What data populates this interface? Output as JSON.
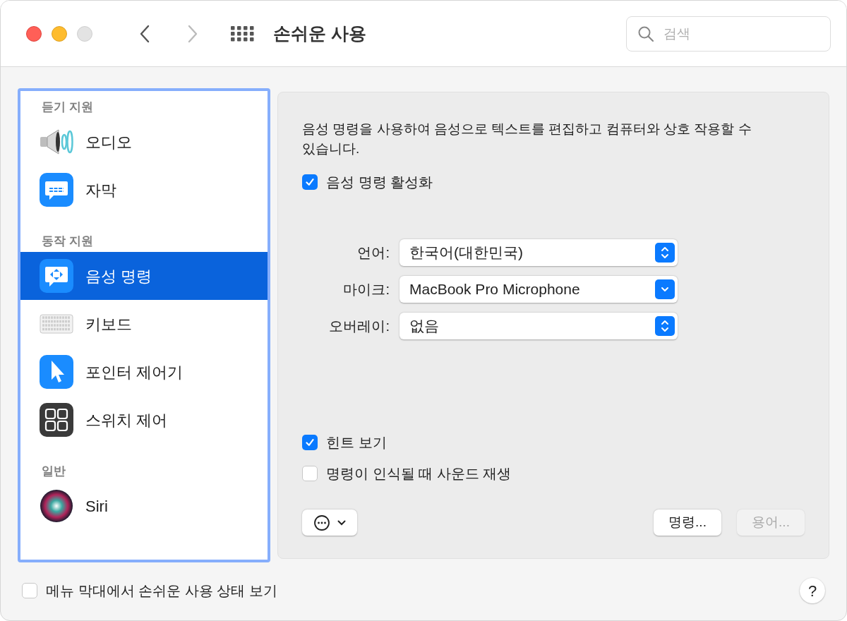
{
  "window": {
    "title": "손쉬운 사용",
    "back_disabled": false,
    "forward_disabled": true
  },
  "search": {
    "placeholder": "검색"
  },
  "sidebar": {
    "sections": [
      {
        "header": "듣기 지원",
        "items": [
          {
            "label": "오디오",
            "kind": "speaker",
            "selected": false
          },
          {
            "label": "자막",
            "kind": "captions",
            "selected": false
          }
        ]
      },
      {
        "header": "동작 지원",
        "items": [
          {
            "label": "음성 명령",
            "kind": "voice",
            "selected": true
          },
          {
            "label": "키보드",
            "kind": "keyboard",
            "selected": false
          },
          {
            "label": "포인터 제어기",
            "kind": "pointer",
            "selected": false
          },
          {
            "label": "스위치 제어",
            "kind": "switch",
            "selected": false
          }
        ]
      },
      {
        "header": "일반",
        "items": [
          {
            "label": "Siri",
            "kind": "siri",
            "selected": false
          }
        ]
      }
    ]
  },
  "panel": {
    "description": "음성 명령을 사용하여 음성으로 텍스트를 편집하고 컴퓨터와 상호 작용할 수 있습니다.",
    "enable": {
      "label": "음성 명령 활성화",
      "checked": true
    },
    "popups": [
      {
        "label": "언어:",
        "value": "한국어(대한민국)",
        "kind": "stepper"
      },
      {
        "label": "마이크:",
        "value": "MacBook Pro Microphone",
        "kind": "popup"
      },
      {
        "label": "오버레이:",
        "value": "없음",
        "kind": "stepper"
      }
    ],
    "options": [
      {
        "label": "힌트 보기",
        "checked": true
      },
      {
        "label": "명령이 인식될 때 사운드 재생",
        "checked": false
      }
    ],
    "buttons": [
      {
        "label": "명령...",
        "disabled": false
      },
      {
        "label": "용어...",
        "disabled": true
      }
    ]
  },
  "footer": {
    "checkbox": {
      "label": "메뉴 막대에서 손쉬운 사용 상태 보기",
      "checked": false
    },
    "help": "?"
  }
}
